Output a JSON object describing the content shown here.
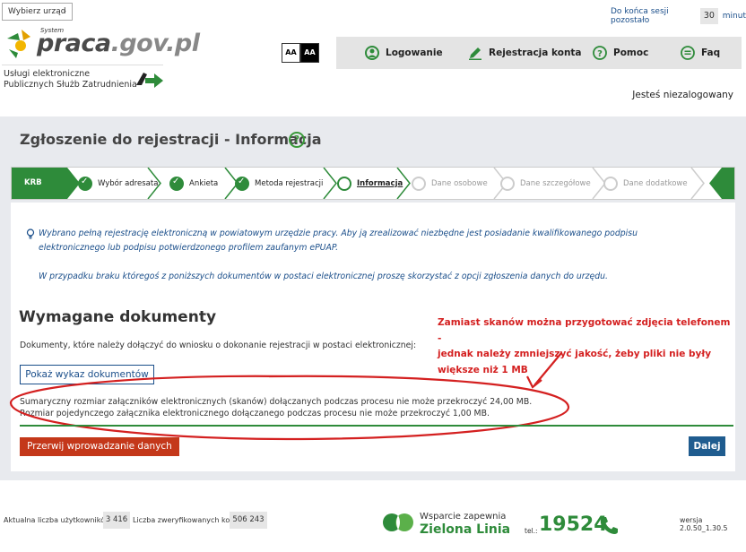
{
  "header": {
    "choose_office": "Wybierz urząd",
    "choose_office_chev": "›",
    "logo_sys": "System",
    "logo_brand": "praca",
    "logo_domain": ".gov.pl",
    "subtitle_line1": "Usługi elektroniczne",
    "subtitle_line2": "Publicznych Służb Zatrudnienia",
    "contrast_a": "AA",
    "contrast_b": "AA",
    "session_label": "Do końca sesji pozostało",
    "session_minutes": "30",
    "session_unit": "minut",
    "nav": {
      "login": "Logowanie",
      "register": "Rejestracja konta",
      "help": "Pomoc",
      "faq": "Faq"
    },
    "status": "Jesteś niezalogowany"
  },
  "page": {
    "title": "Zgłoszenie do rejestracji - Informacja",
    "help_glyph": "?"
  },
  "stepper": {
    "krb": "KRB",
    "steps": [
      {
        "label": "Wybór adresata",
        "state": "done"
      },
      {
        "label": "Ankieta",
        "state": "done"
      },
      {
        "label": "Metoda rejestracji",
        "state": "done"
      },
      {
        "label": "Informacja",
        "state": "current"
      },
      {
        "label": "Dane osobowe",
        "state": "future"
      },
      {
        "label": "Dane szczegółowe",
        "state": "future"
      },
      {
        "label": "Dane dodatkowe",
        "state": "future"
      }
    ]
  },
  "info": {
    "line1": "Wybrano pełną rejestrację elektroniczną w powiatowym urzędzie pracy. Aby ją zrealizować niezbędne jest posiadanie kwalifikowanego podpisu",
    "line2": "elektronicznego lub podpisu potwierdzonego profilem zaufanym ePUAP.",
    "line3": "W przypadku braku któregoś z poniższych dokumentów w postaci elektronicznej proszę skorzystać z opcji zgłoszenia danych do urzędu."
  },
  "documents": {
    "title": "Wymagane dokumenty",
    "description": "Dokumenty, które należy dołączyć do wniosku o dokonanie rejestracji w postaci elektronicznej:",
    "show_button": "Pokaż wykaz dokumentów",
    "size_total": "Sumaryczny rozmiar załączników elektronicznych (skanów) dołączanych podczas procesu nie może przekroczyć 24,00 MB.",
    "size_single": "Rozmiar pojedynczego załącznika elektronicznego dołączanego podczas procesu nie może przekroczyć 1,00 MB."
  },
  "annotation": {
    "line1": "Zamiast skanów można przygotować zdjęcia telefonem -",
    "line2": "jednak należy zmniejszyć jakość, żeby pliki nie były",
    "line3": "większe niż 1 MB",
    "color": "#d42020"
  },
  "actions": {
    "stop": "Przerwij wprowadzanie danych",
    "next": "Dalej"
  },
  "footer": {
    "users_label": "Aktualna liczba użytkowników:",
    "users_value": "3 416",
    "verified_label": "Liczba zweryfikowanych kont:",
    "verified_value": "506 243",
    "support_line1": "Wsparcie zapewnia",
    "support_line2": "Zielona Linia",
    "tel_label": "tel.:",
    "tel_number": "19524",
    "version": "wersja 2.0.50_1.30.5"
  },
  "colors": {
    "green": "#2e8b3a",
    "blue": "#1a4e8a",
    "stop_red": "#c4381a",
    "next_blue": "#1f5c8f"
  }
}
